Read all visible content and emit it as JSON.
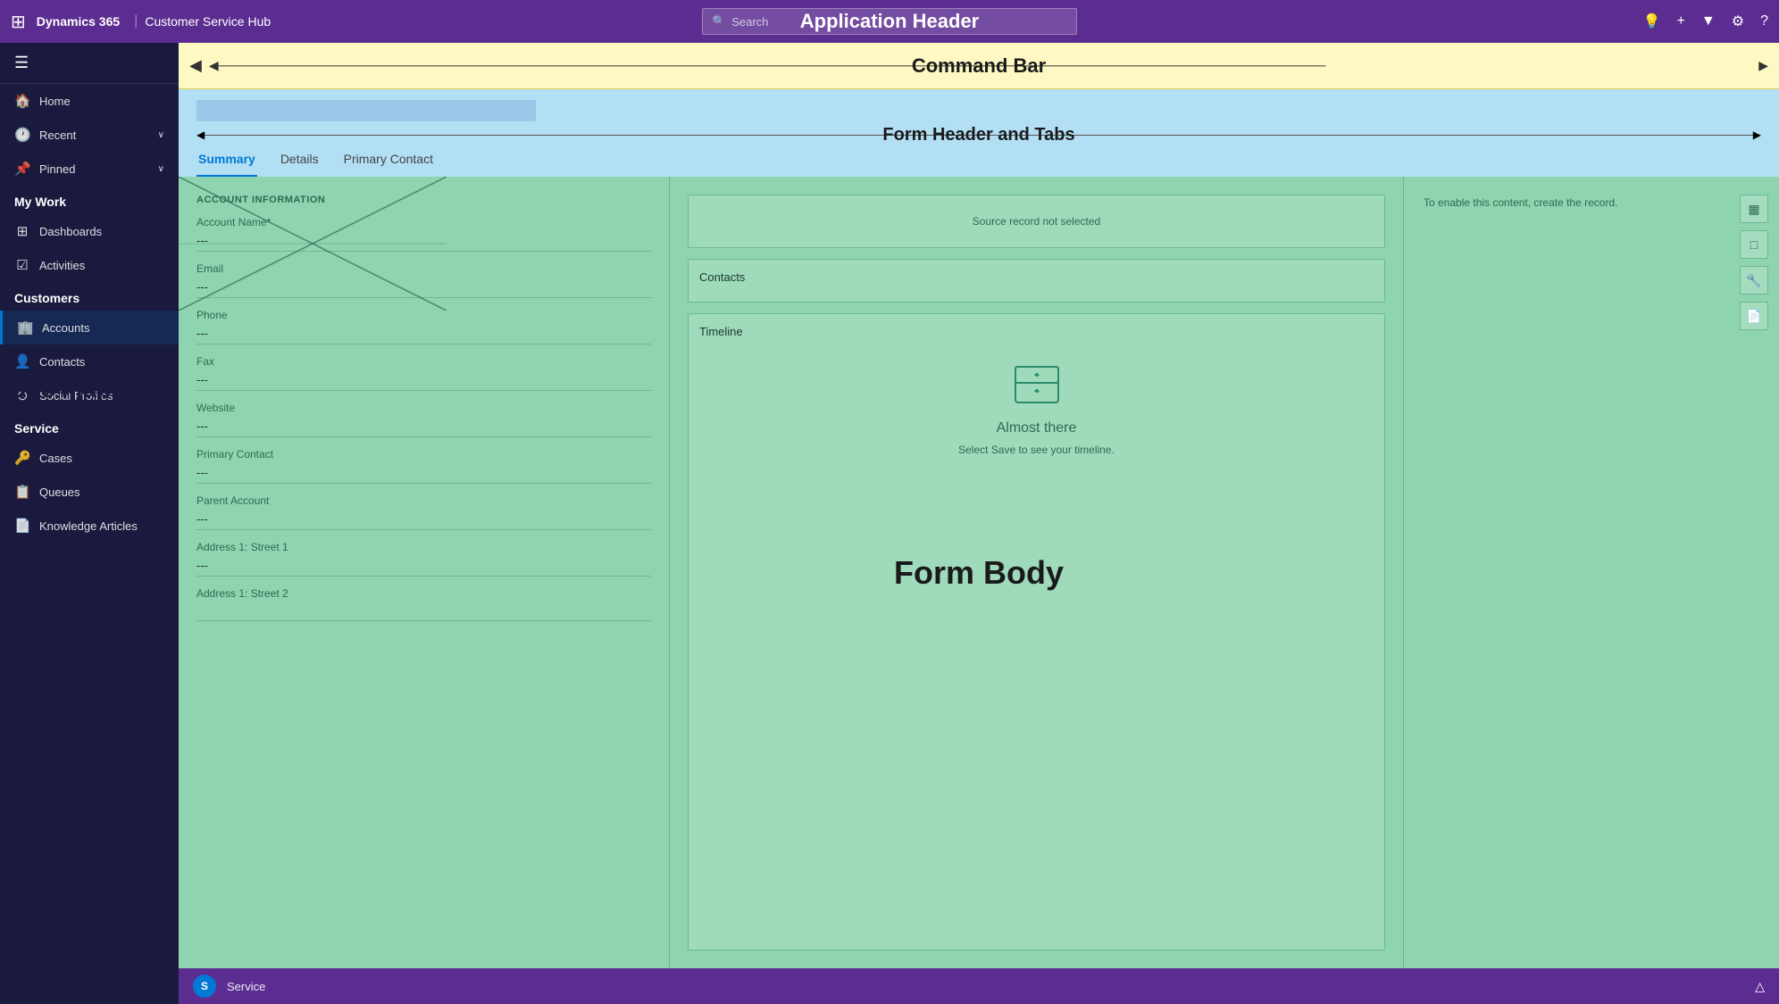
{
  "appHeader": {
    "waffle": "⊞",
    "brand": "Dynamics 365",
    "separator": "|",
    "module": "Customer Service Hub",
    "searchPlaceholder": "Search",
    "label": "Application Header",
    "icons": [
      "💡",
      "+",
      "▼",
      "⚙",
      "?"
    ]
  },
  "commandBar": {
    "label": "Command Bar",
    "backIcon": "◀",
    "arrowLeft": "◀",
    "arrowRight": "▶"
  },
  "formHeader": {
    "label": "Form Header and Tabs",
    "tabs": [
      {
        "id": "summary",
        "label": "Summary",
        "active": true
      },
      {
        "id": "details",
        "label": "Details",
        "active": false
      },
      {
        "id": "primary-contact",
        "label": "Primary Contact",
        "active": false
      }
    ]
  },
  "formBody": {
    "label": "Form Body",
    "sitemapLabel": "Site Map"
  },
  "sidebar": {
    "hamburger": "☰",
    "items": [
      {
        "id": "home",
        "icon": "🏠",
        "label": "Home",
        "hasChevron": false
      },
      {
        "id": "recent",
        "icon": "🕐",
        "label": "Recent",
        "hasChevron": true
      },
      {
        "id": "pinned",
        "icon": "📌",
        "label": "Pinned",
        "hasChevron": true
      }
    ],
    "sections": [
      {
        "id": "my-work",
        "label": "My Work",
        "items": [
          {
            "id": "dashboards",
            "icon": "⊞",
            "label": "Dashboards"
          },
          {
            "id": "activities",
            "icon": "☑",
            "label": "Activities"
          }
        ]
      },
      {
        "id": "customers",
        "label": "Customers",
        "items": [
          {
            "id": "accounts",
            "icon": "🏢",
            "label": "Accounts",
            "active": true
          },
          {
            "id": "contacts",
            "icon": "👤",
            "label": "Contacts"
          },
          {
            "id": "social-profiles",
            "icon": "⊙",
            "label": "Social Profiles"
          }
        ]
      },
      {
        "id": "service",
        "label": "Service",
        "items": [
          {
            "id": "cases",
            "icon": "🔑",
            "label": "Cases"
          },
          {
            "id": "queues",
            "icon": "📋",
            "label": "Queues"
          },
          {
            "id": "knowledge-articles",
            "icon": "📄",
            "label": "Knowledge Articles"
          }
        ]
      }
    ]
  },
  "accountInfo": {
    "sectionTitle": "ACCOUNT INFORMATION",
    "fields": [
      {
        "label": "Account Name*",
        "value": "---"
      },
      {
        "label": "Email",
        "value": "---"
      },
      {
        "label": "Phone",
        "value": "---"
      },
      {
        "label": "Fax",
        "value": "---"
      },
      {
        "label": "Website",
        "value": "---"
      },
      {
        "label": "Primary Contact",
        "value": "---"
      },
      {
        "label": "Parent Account",
        "value": "---"
      },
      {
        "label": "Address 1: Street 1",
        "value": "---"
      },
      {
        "label": "Address 1: Street 2",
        "value": ""
      }
    ]
  },
  "midPanels": {
    "sourcePanel": {
      "message": "Source record not selected"
    },
    "contactsPanel": {
      "title": "Contacts"
    },
    "timelinePanel": {
      "title": "Timeline",
      "almostThereTitle": "Almost there",
      "almostThereSub": "Select Save to see your timeline."
    }
  },
  "rightPanel": {
    "message": "To enable this content, create the record.",
    "icons": [
      "▦",
      "□",
      "🔧",
      "📄"
    ]
  },
  "footer": {
    "avatarLabel": "S",
    "label": "Service",
    "expandIcon": "△"
  }
}
